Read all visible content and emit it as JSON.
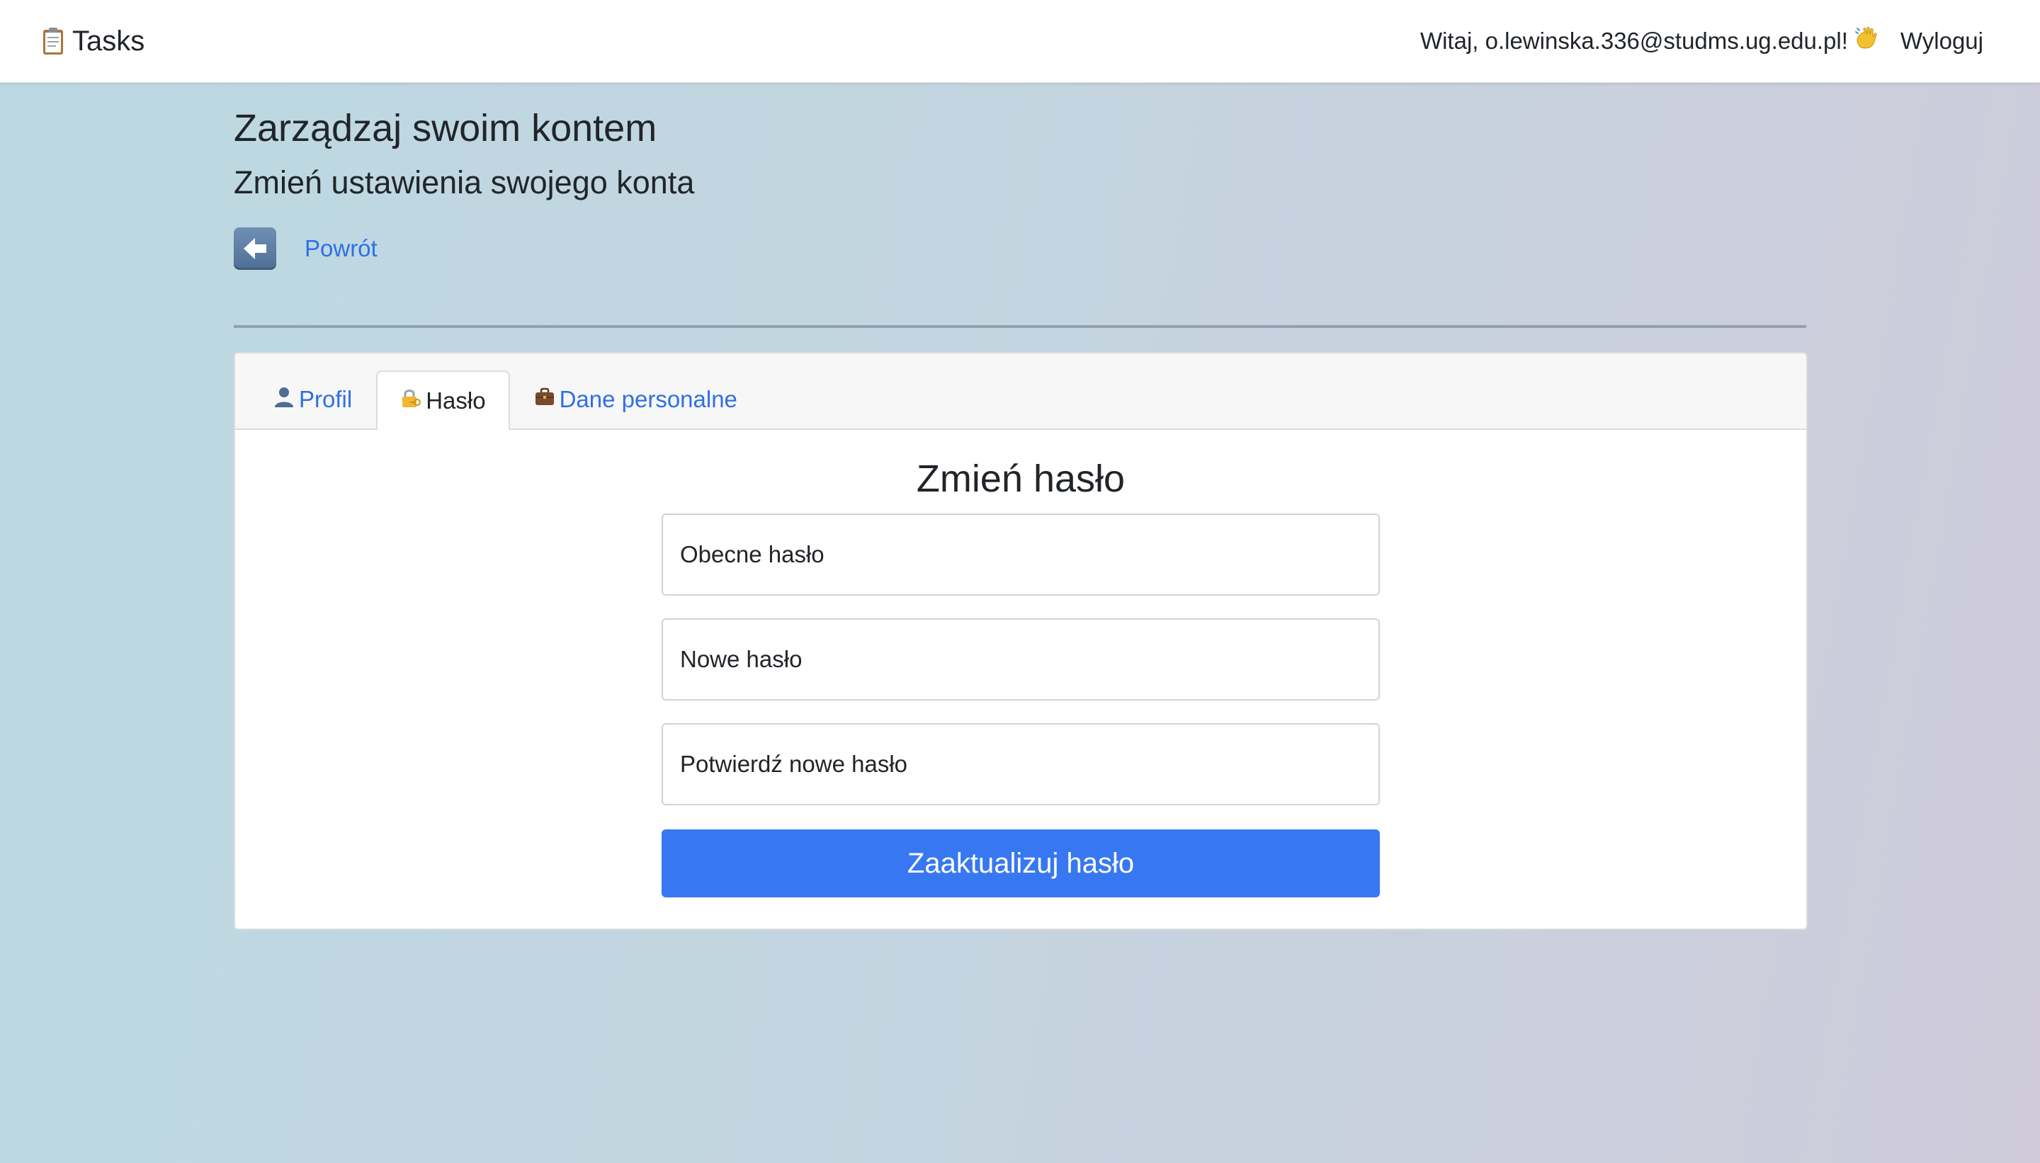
{
  "navbar": {
    "brand_icon": "clipboard-icon",
    "brand_label": "Tasks",
    "greeting": "Witaj, o.lewinska.336@studms.ug.edu.pl!",
    "greeting_icon": "wave-icon",
    "logout_label": "Wyloguj"
  },
  "header": {
    "title": "Zarządzaj swoim kontem",
    "subtitle": "Zmień ustawienia swojego konta",
    "back_icon": "left-arrow-icon",
    "back_label": "Powrót"
  },
  "tabs": [
    {
      "icon": "user-icon",
      "label": "Profil",
      "active": false
    },
    {
      "icon": "lock-key-icon",
      "label": "Hasło",
      "active": true
    },
    {
      "icon": "briefcase-icon",
      "label": "Dane personalne",
      "active": false
    }
  ],
  "form": {
    "title": "Zmień hasło",
    "current_password": {
      "placeholder": "Obecne hasło",
      "value": ""
    },
    "new_password": {
      "placeholder": "Nowe hasło",
      "value": ""
    },
    "confirm_password": {
      "placeholder": "Potwierdź nowe hasło",
      "value": ""
    },
    "submit_label": "Zaaktualizuj hasło"
  },
  "colors": {
    "accent": "#3778f2",
    "link": "#2f6fe6",
    "text": "#212529"
  }
}
